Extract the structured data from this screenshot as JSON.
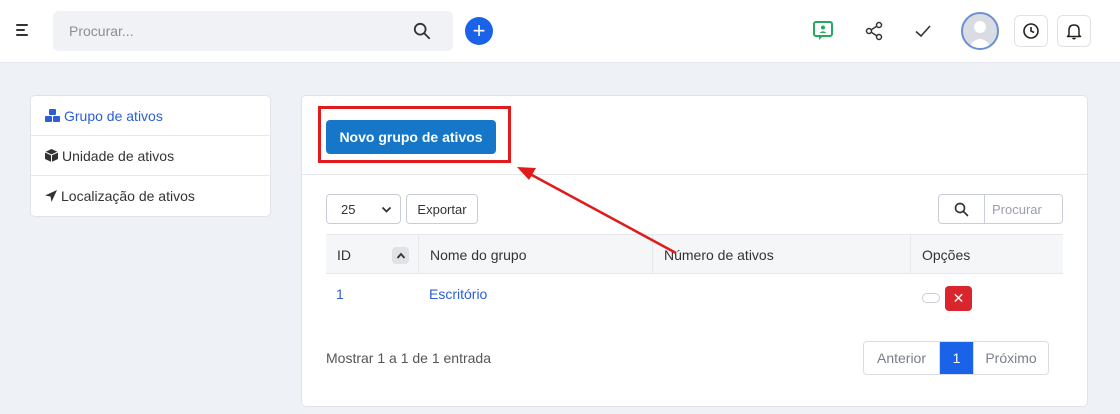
{
  "topbar": {
    "search_placeholder": "Procurar...",
    "add_label": "+"
  },
  "sidebar": {
    "items": [
      {
        "label": "Grupo de ativos",
        "icon": "cubes-icon",
        "active": true
      },
      {
        "label": "Unidade de ativos",
        "icon": "cube-icon",
        "active": false
      },
      {
        "label": "Localização de ativos",
        "icon": "location-arrow-icon",
        "active": false
      }
    ]
  },
  "main": {
    "new_button_label": "Novo grupo de ativos",
    "page_size": "25",
    "export_label": "Exportar",
    "table_search_placeholder": "Procurar",
    "columns": [
      "ID",
      "Nome do grupo",
      "Número de ativos",
      "Opções"
    ],
    "rows": [
      {
        "id": "1",
        "name": "Escritório",
        "count": ""
      }
    ],
    "delete_label": "✕",
    "info": "Mostrar 1 a 1 de 1 entrada",
    "pagination": {
      "prev": "Anterior",
      "current": "1",
      "next": "Próximo"
    }
  },
  "colors": {
    "accent": "#1a62e8",
    "primary_button": "#1677c9",
    "danger": "#d9262c",
    "annotation": "#e11b1b",
    "link": "#2c5fd6"
  }
}
